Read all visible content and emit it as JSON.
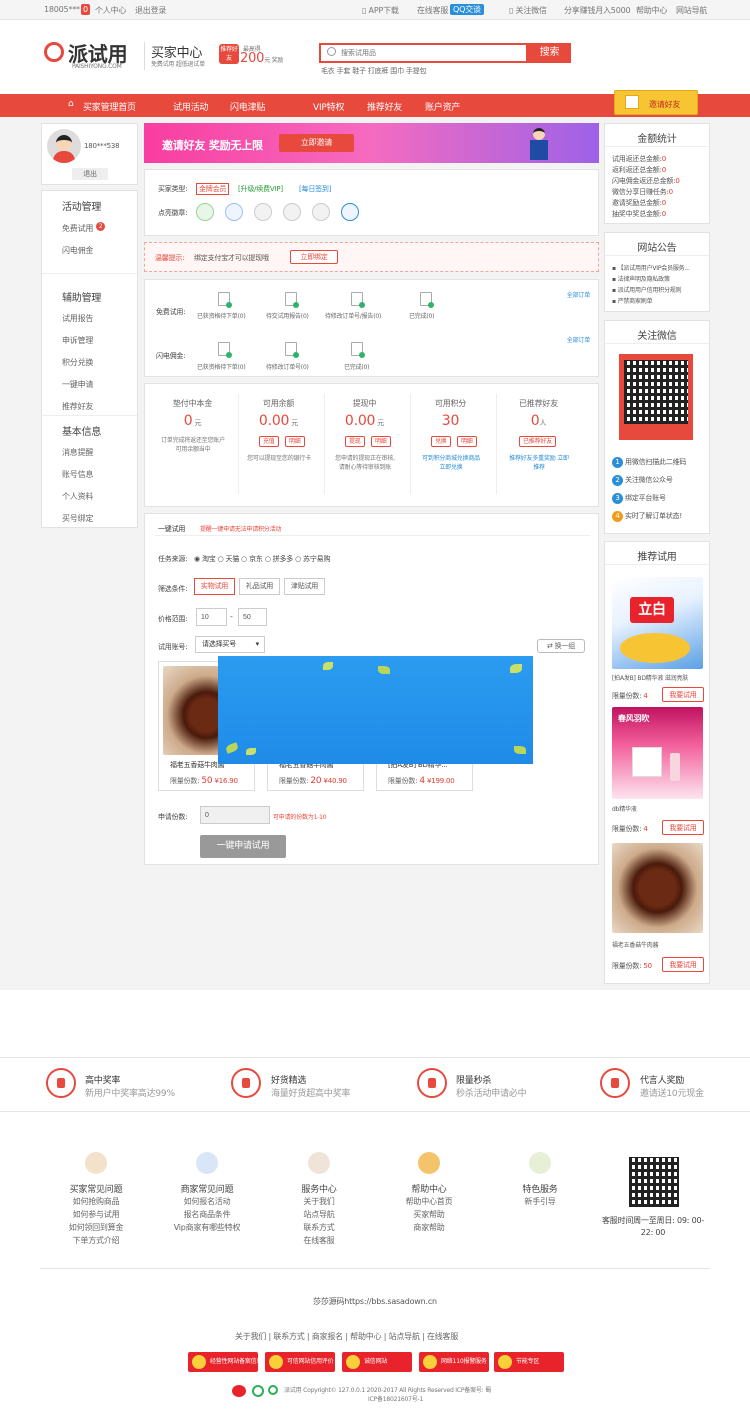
{
  "topbar": {
    "user": "18005***",
    "msg_count": "0",
    "personal": "个人中心",
    "logout": "退出登录",
    "app": "APP下载",
    "service": "在线客服",
    "qq": "QQ交谈",
    "wechat": "关注微信",
    "share": "分享赚钱月入5000",
    "help": "帮助中心",
    "nav": "网站导航"
  },
  "header": {
    "logo": "派试用",
    "logo_sub": "PAISHIYONG.COM",
    "center_title": "买家中心",
    "center_sub": "免费试用 超低退试单",
    "invite_tag": "推荐好友",
    "invite_top": "最高得",
    "invite_amount": "200",
    "invite_unit": "元 奖励",
    "search_placeholder": "搜索试用品",
    "search_btn": "搜索",
    "hot": "毛衣 手套 鞋子 打底裤 围巾 手提包"
  },
  "nav": {
    "items": [
      "买家管理首页",
      "试用活动",
      "闪电津贴",
      "VIP特权",
      "推荐好友",
      "账户资产"
    ],
    "invite_btn": "邀请好友"
  },
  "left": {
    "username": "180***538",
    "logout": "退出",
    "g1": "活动管理",
    "g1_items": [
      "免费试用",
      "闪电佣金"
    ],
    "g1_badge": "2",
    "g2": "辅助管理",
    "g2_items": [
      "试用报告",
      "申诉管理",
      "积分兑换",
      "一键申请",
      "推荐好友"
    ],
    "g3": "基本信息",
    "g3_items": [
      "消息提醒",
      "账号信息",
      "个人资料",
      "买号绑定"
    ]
  },
  "banner": {
    "text": "邀请好友 奖励无上限",
    "btn": "立即邀请"
  },
  "account": {
    "type_label": "买家类型:",
    "type_val": "金牌会员",
    "upgrade": "[升级/续费VIP]",
    "sign": "[每日签到]",
    "badge_label": "点亮徽章:"
  },
  "tip": {
    "label": "温馨提示:",
    "text": "绑定支付宝才可以提现哦",
    "btn": "立即绑定"
  },
  "orders": {
    "all": "全部订单",
    "free_label": "免费试用:",
    "free_items": [
      "已获资格待下单(0)",
      "待交试用报告(0)",
      "待修改订单号/报告(0)",
      "已完成(0)"
    ],
    "flash_label": "闪电佣金:",
    "flash_items": [
      "已获资格待下单(0)",
      "待修改订单号(0)",
      "已完成(0)"
    ]
  },
  "stats": [
    {
      "title": "垫付中本金",
      "value": "0",
      "unit": "元",
      "btns": [],
      "desc": "订单完成将返还至您账户可用余额当中"
    },
    {
      "title": "可用余额",
      "value": "0.00",
      "unit": "元",
      "btns": [
        "充值",
        "明细"
      ],
      "desc": "您可以提现至您的银行卡"
    },
    {
      "title": "提现中",
      "value": "0.00",
      "unit": "元",
      "btns": [
        "提现",
        "明细"
      ],
      "desc": "您申请的提现正在审核,请耐心等待审核到账"
    },
    {
      "title": "可用积分",
      "value": "30",
      "unit": "",
      "btns": [
        "兑换",
        "明细"
      ],
      "desc": "可到积分商城兑换商品 立即兑换"
    },
    {
      "title": "已推荐好友",
      "value": "0",
      "unit": "人",
      "btns": [
        "已推荐好友"
      ],
      "desc": "推荐好友多重奖励 立即推荐"
    }
  ],
  "apply": {
    "title": "一键试用",
    "note": "提醒一键申请无法申请积分活动",
    "source_label": "任务来源:",
    "sources": [
      "淘宝",
      "天猫",
      "京东",
      "拼多多",
      "苏宁易购"
    ],
    "filter_label": "筛选条件:",
    "filters": [
      "实物试用",
      "礼品试用",
      "津贴试用"
    ],
    "price_label": "价格范围:",
    "price_min": "10",
    "price_max": "50",
    "account_label": "试用账号:",
    "account_select": "请选择买号",
    "refresh": "换一组",
    "products": [
      {
        "name": "福老五香菇牛肉酱",
        "quota": "限量份数:",
        "count": "50",
        "price": "¥16.90"
      },
      {
        "name": "福老五香菇牛肉酱",
        "quota": "限量份数:",
        "count": "20",
        "price": "¥40.90"
      },
      {
        "name": "[拍A发B] BD精华...",
        "quota": "限量份数:",
        "count": "4",
        "price": "¥199.00"
      }
    ],
    "apply_count_label": "申请份数:",
    "apply_count": "0",
    "apply_hint": "可申请的份数为1-10",
    "submit": "一键申请试用"
  },
  "right": {
    "money_title": "金额统计",
    "money_lines": [
      "试用返还总金额:",
      "返利返还总金额:",
      "闪电佣金返还总金额:",
      "微信分享日赚任务:",
      "邀请奖励总金额:",
      "抽奖中奖总金额:"
    ],
    "money_vals": [
      "0",
      "0",
      "0",
      "0",
      "0",
      "0"
    ],
    "notice_title": "网站公告",
    "notices": [
      "【派试用用户VIP会员服务...",
      "法律声明及隐私政策",
      "派试用用户信用积分规则",
      "严禁商家刷单"
    ],
    "wechat_title": "关注微信",
    "steps": [
      "用微信扫描此二维码",
      "关注微信公众号",
      "绑定平台账号",
      "实时了解订单状态!"
    ],
    "rec_title": "推荐试用",
    "rec": [
      {
        "name": "[拍A发B] BD精华液 滋润亮肤",
        "quota": "限量份数:",
        "count": "4",
        "btn": "我要试用"
      },
      {
        "name": "db精华液",
        "quota": "限量份数:",
        "count": "4",
        "btn": "我要试用"
      },
      {
        "name": "福老五香菇牛肉酱",
        "quota": "限量份数:",
        "count": "50",
        "btn": "我要试用"
      }
    ],
    "ad1": "立白",
    "ad2": "春风羽吹"
  },
  "features": [
    {
      "title": "高中奖率",
      "sub": "新用户中奖率高达99%"
    },
    {
      "title": "好货精选",
      "sub": "海量好货超高中奖率"
    },
    {
      "title": "限量秒杀",
      "sub": "秒杀活动申请必中"
    },
    {
      "title": "代言人奖励",
      "sub": "邀请送10元现金"
    }
  ],
  "footer": {
    "cols": [
      {
        "title": "买家常见问题",
        "links": [
          "如何抢购商品",
          "如何参与试用",
          "如何领回到算金",
          "下单方式介绍"
        ]
      },
      {
        "title": "商家常见问题",
        "links": [
          "如何报名活动",
          "报名商品条件",
          "Vip商家有哪些特权"
        ]
      },
      {
        "title": "服务中心",
        "links": [
          "关于我们",
          "站点导航",
          "联系方式",
          "在线客服"
        ]
      },
      {
        "title": "帮助中心",
        "links": [
          "帮助中心首页",
          "买家帮助",
          "商家帮助"
        ]
      },
      {
        "title": "特色服务",
        "links": [
          "新手引导"
        ]
      }
    ],
    "service_time": "客服时间周一至周日: 09: 00-22: 00",
    "source": "莎莎源码https://bbs.sasadown.cn",
    "links": [
      "关于我们",
      "联系方式",
      "商家报名",
      "帮助中心",
      "站点导航",
      "在线客服"
    ],
    "badges": [
      "经营性网站备案信息",
      "可信网站信用评价",
      "诚信网站",
      "网络110报警服务",
      "节能专区"
    ],
    "copyright": "派试用 Copyright© 127.0.0.1 2020-2017 All Rights Reserved ICP备案号: 蜀",
    "icp": "ICP备18021607号-1"
  }
}
